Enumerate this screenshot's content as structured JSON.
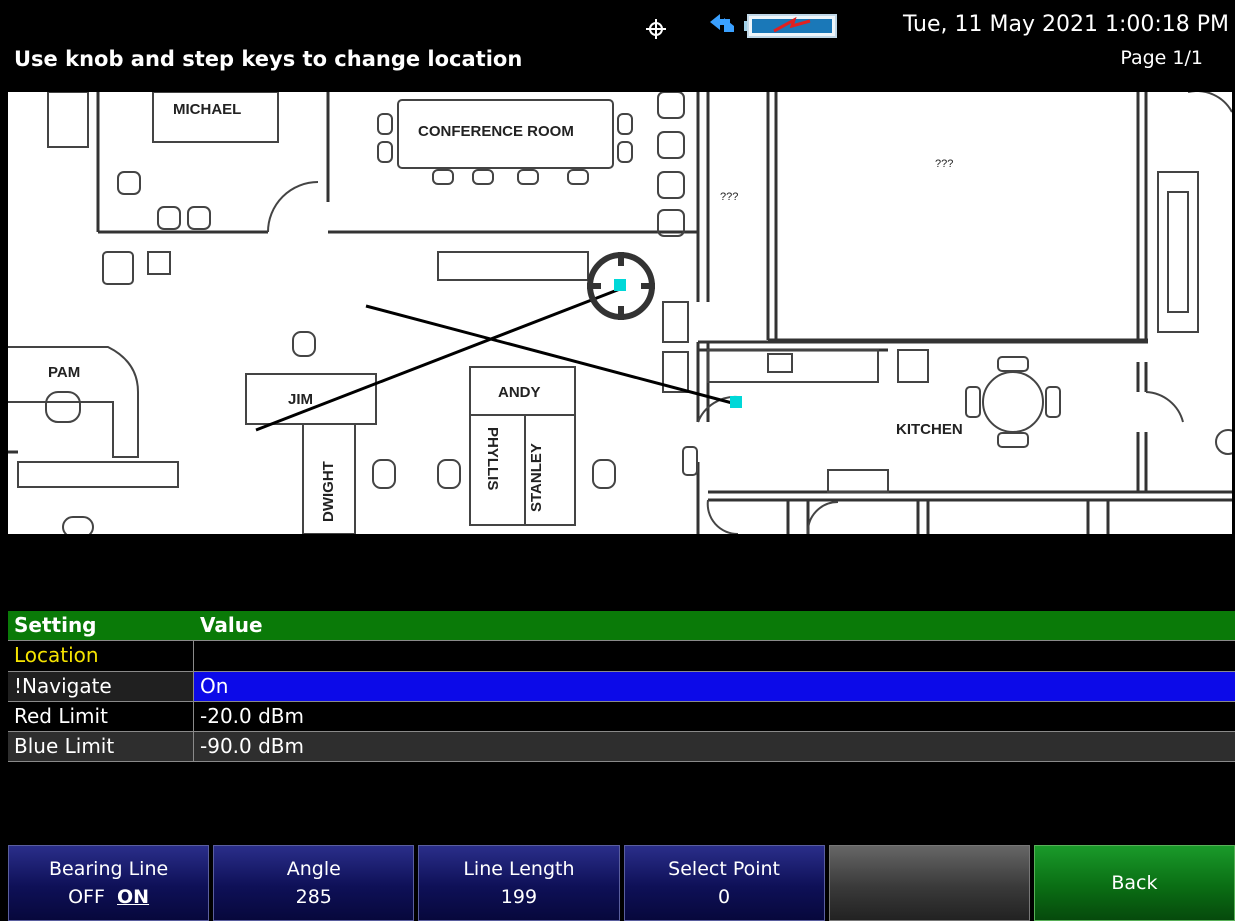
{
  "status": {
    "instruction": "Use knob and step keys to change location",
    "datetime": "Tue, 11 May 2021 1:00:18 PM",
    "page": "Page 1/1"
  },
  "floorplan": {
    "rooms": [
      "MICHAEL",
      "CONFERENCE ROOM",
      "???",
      "???",
      "PAM",
      "JIM",
      "ANDY",
      "DWIGHT",
      "PHYLLIS",
      "STANLEY",
      "KITCHEN"
    ]
  },
  "table": {
    "header": {
      "setting": "Setting",
      "value": "Value"
    },
    "rows": [
      {
        "setting": "Location",
        "value": ""
      },
      {
        "setting": "!Navigate",
        "value": "On"
      },
      {
        "setting": "Red Limit",
        "value": "-20.0 dBm"
      },
      {
        "setting": "Blue Limit",
        "value": "-90.0 dBm"
      }
    ]
  },
  "softkeys": [
    {
      "label": "Bearing Line",
      "off": "OFF",
      "on": "ON"
    },
    {
      "label": "Angle",
      "value": "285"
    },
    {
      "label": "Line Length",
      "value": "199"
    },
    {
      "label": "Select Point",
      "value": "0"
    },
    {
      "label": ""
    },
    {
      "label": "Back"
    }
  ],
  "colors": {
    "header_green": "#0a7a08",
    "selected_blue": "#0c0ae8",
    "location_yellow": "#f5e300",
    "marker_cyan": "#00d8d8"
  }
}
